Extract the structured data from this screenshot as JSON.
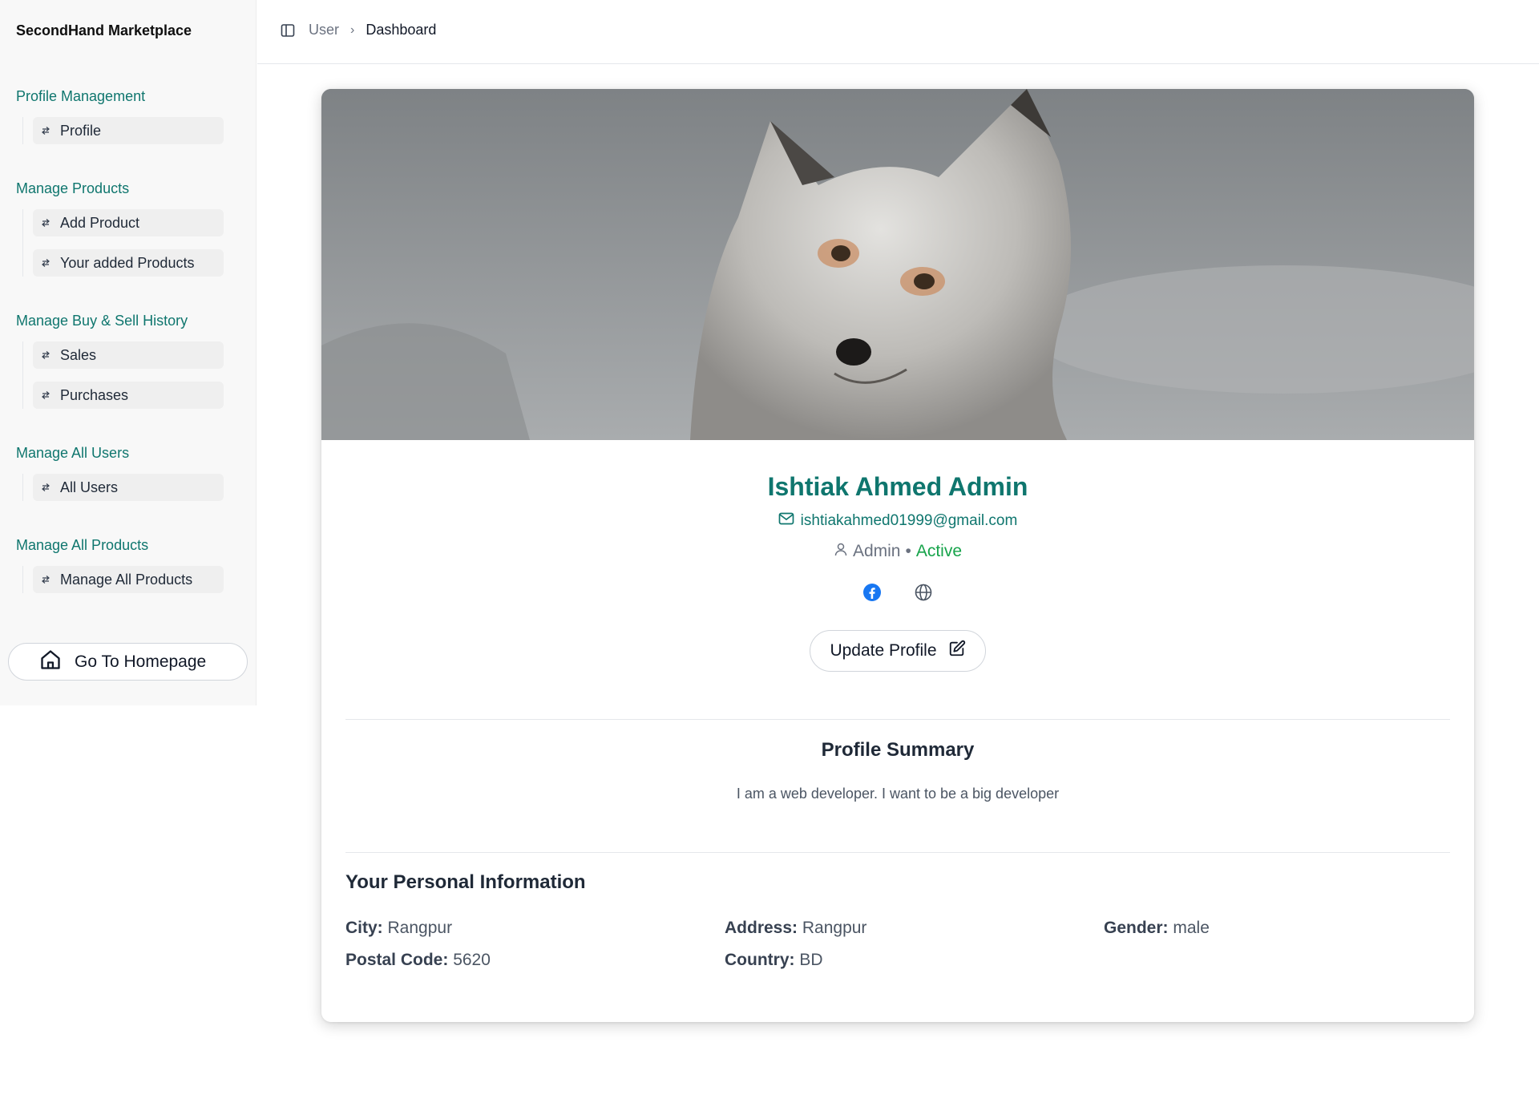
{
  "sidebar": {
    "brand": "SecondHand Marketplace",
    "sections": [
      {
        "heading": "Profile Management",
        "items": [
          "Profile"
        ]
      },
      {
        "heading": "Manage Products",
        "items": [
          "Add Product",
          "Your added Products"
        ]
      },
      {
        "heading": "Manage Buy & Sell History",
        "items": [
          "Sales",
          "Purchases"
        ]
      },
      {
        "heading": "Manage All Users",
        "items": [
          "All Users"
        ]
      },
      {
        "heading": "Manage All Products",
        "items": [
          "Manage All Products"
        ]
      }
    ],
    "home_button": "Go To Homepage"
  },
  "header": {
    "breadcrumb": [
      "User",
      "Dashboard"
    ],
    "separator": "›"
  },
  "profile": {
    "name": "Ishtiak Ahmed Admin",
    "email": "ishtiakahmed01999@gmail.com",
    "role": "Admin",
    "dot": "•",
    "status": "Active",
    "update_button": "Update Profile"
  },
  "summary": {
    "title": "Profile Summary",
    "text": "I am a web developer. I want to be a big developer"
  },
  "personal_info": {
    "title": "Your Personal Information",
    "fields": [
      {
        "key": "City:",
        "value": "Rangpur"
      },
      {
        "key": "Address:",
        "value": "Rangpur"
      },
      {
        "key": "Gender:",
        "value": "male"
      },
      {
        "key": "Postal Code:",
        "value": "5620"
      },
      {
        "key": "Country:",
        "value": "BD"
      }
    ]
  },
  "icons": {
    "nav_item": "arrows-icon",
    "home": "home-icon",
    "sidebar_toggle": "panel-left-icon",
    "email": "mail-icon",
    "role": "user-icon",
    "facebook": "facebook-icon",
    "website": "globe-icon",
    "edit": "edit-icon"
  },
  "colors": {
    "accent": "#0f766e",
    "status_active": "#16a34a",
    "facebook": "#1877f2"
  }
}
